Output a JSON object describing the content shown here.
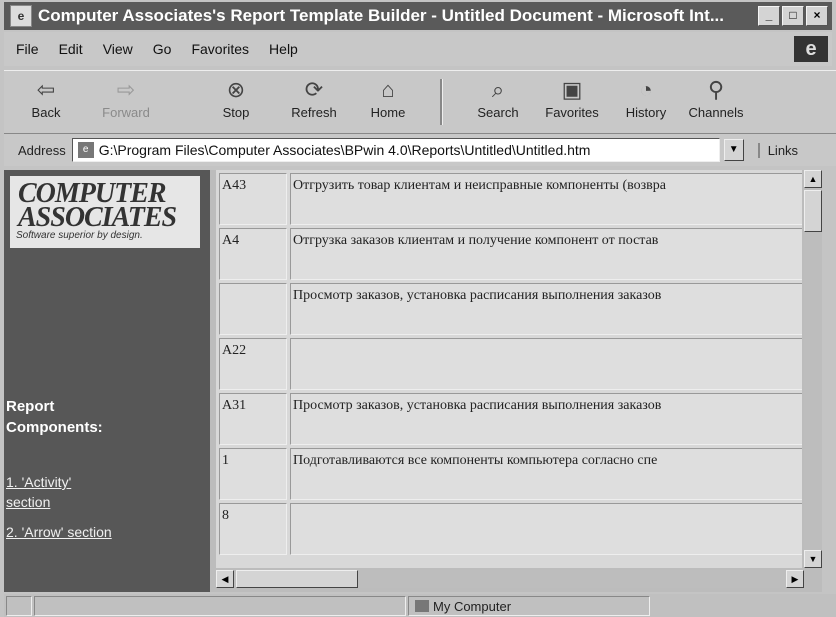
{
  "window": {
    "title": "Computer Associates's Report Template Builder - Untitled Document - Microsoft Int...",
    "controls": [
      "_",
      "□",
      "×"
    ]
  },
  "menu": [
    {
      "label": "File"
    },
    {
      "label": "Edit"
    },
    {
      "label": "View"
    },
    {
      "label": "Go"
    },
    {
      "label": "Favorites"
    },
    {
      "label": "Help"
    }
  ],
  "toolbar": {
    "back": "Back",
    "forward": "Forward",
    "stop": "Stop",
    "refresh": "Refresh",
    "home": "Home",
    "search": "Search",
    "favorites": "Favorites",
    "history": "History",
    "channels": "Channels"
  },
  "address": {
    "label": "Address",
    "value": "G:\\Program Files\\Computer Associates\\BPwin 4.0\\Reports\\Untitled\\Untitled.htm",
    "links_label": "Links"
  },
  "sidebar": {
    "logo_line1": "COMPUTER",
    "logo_line2": "ASSOCIATES",
    "logo_tagline": "Software superior by design.",
    "heading_line1": "Report",
    "heading_line2": "Components:",
    "link1_line1": "1. 'Activity'",
    "link1_line2": "section",
    "link2": "2. 'Arrow' section"
  },
  "table": {
    "rows": [
      {
        "num": "A43",
        "desc": "Отгрузить товар клиентам и неисправные компоненты (возвра"
      },
      {
        "num": "A4",
        "desc": "Отгрузка заказов клиентам и получение компонент от постав"
      },
      {
        "num": "",
        "desc": "Просмотр заказов, установка расписания выполнения заказов"
      },
      {
        "num": "A22",
        "desc": ""
      },
      {
        "num": "A31",
        "desc": "Просмотр заказов, установка расписания выполнения заказов"
      },
      {
        "num": "1",
        "desc": "Подготавливаются все компоненты компьютера согласно спе"
      },
      {
        "num": "8",
        "desc": ""
      }
    ]
  },
  "status": {
    "zone": "My Computer"
  }
}
